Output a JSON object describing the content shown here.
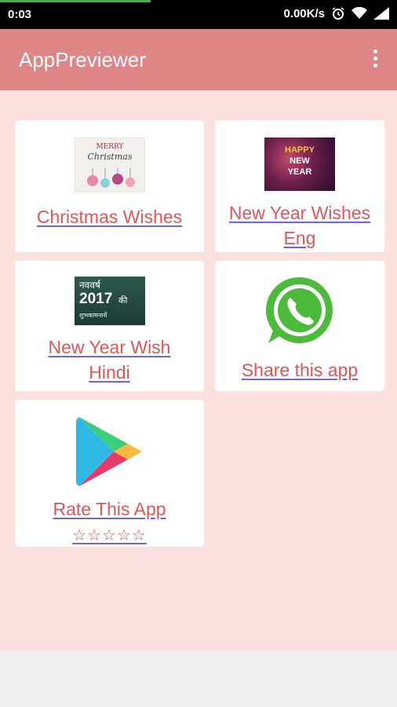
{
  "status_bar": {
    "time": "0:03",
    "speed": "0.00K/s",
    "icons": [
      "alarm-icon",
      "wifi-icon",
      "signal-icon"
    ]
  },
  "app_bar": {
    "title": "AppPreviewer",
    "menu_icon": "overflow-menu-icon",
    "color": "#de8585"
  },
  "colors": {
    "background": "#fde0e0",
    "label": "#e05555",
    "underline": "#6666ee"
  },
  "cards": {
    "christmas": {
      "line1": "Christmas Wishes",
      "thumb_text_1": "MERRY",
      "thumb_text_2": "Christmas"
    },
    "new_year_eng": {
      "line1": "New Year Wishes",
      "line2": "Eng",
      "thumb_text_1": "HAPPY",
      "thumb_text_2": "NEW",
      "thumb_text_3": "YEAR"
    },
    "new_year_hindi": {
      "line1": "New Year Wish",
      "line2": "Hindi",
      "thumb_text_1": "नववर्ष",
      "thumb_text_2": "2017",
      "thumb_text_3": "की",
      "thumb_text_4": "शुभकामनायें"
    },
    "share": {
      "line1": "Share this app",
      "icon": "whatsapp-icon"
    },
    "rate": {
      "line1": "Rate This App",
      "line2": "☆☆☆☆☆",
      "icon": "play-store-icon"
    }
  }
}
